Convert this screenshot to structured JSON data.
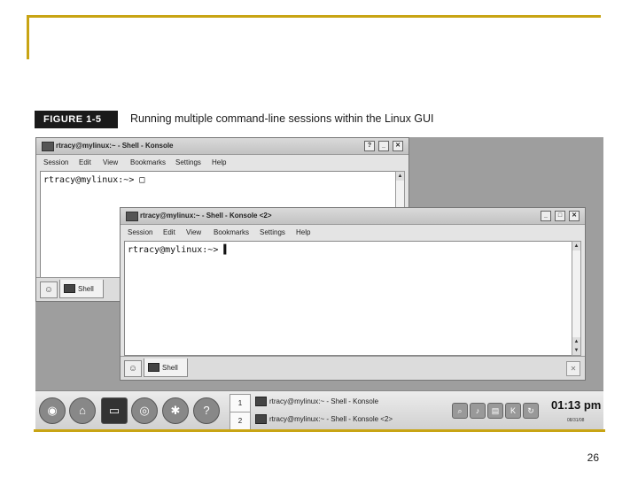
{
  "caption": {
    "label": "FIGURE 1-5",
    "text": "Running multiple command-line sessions within the Linux GUI"
  },
  "page_number": "26",
  "windows": [
    {
      "title": "rtracy@mylinux:~ - Shell - Konsole",
      "menu": [
        "Session",
        "Edit",
        "View",
        "Bookmarks",
        "Settings",
        "Help"
      ],
      "prompt": "rtracy@mylinux:~> ",
      "cursor": "□",
      "tab_label": "Shell",
      "buttons": [
        "?",
        "_",
        "✕"
      ]
    },
    {
      "title": "rtracy@mylinux:~ - Shell - Konsole <2>",
      "menu": [
        "Session",
        "Edit",
        "View",
        "Bookmarks",
        "Settings",
        "Help"
      ],
      "prompt": "rtracy@mylinux:~> ",
      "cursor": "▌",
      "tab_label": "Shell",
      "buttons": [
        "_",
        "□",
        "✕"
      ]
    }
  ],
  "taskbar": {
    "launchers": [
      "kmenu-icon",
      "home-icon",
      "terminal-icon",
      "network-icon",
      "settings-icon",
      "help-icon"
    ],
    "pager": [
      "1",
      "2"
    ],
    "tasks": [
      "rtracy@mylinux:~ - Shell - Konsole",
      "rtracy@mylinux:~ - Shell - Konsole <2>"
    ],
    "tray_icons": [
      "search-icon",
      "volume-icon",
      "clipboard-icon",
      "keyboard-icon",
      "update-icon"
    ],
    "clock_time": "01:13 pm",
    "clock_date": "08/31/08"
  },
  "colors": {
    "accent_gold": "#c8a414",
    "caption_bg": "#1a1a1a",
    "desktop_bg": "#9e9e9e"
  }
}
